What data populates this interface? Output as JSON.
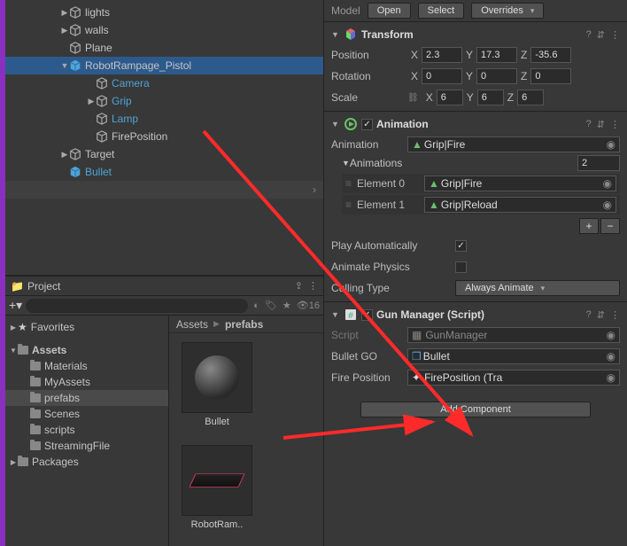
{
  "hierarchy": {
    "items": [
      {
        "name": "lights",
        "indent": 56,
        "arrow": "closed",
        "icon": "cube",
        "blue": false
      },
      {
        "name": "walls",
        "indent": 56,
        "arrow": "closed",
        "icon": "cube",
        "blue": false
      },
      {
        "name": "Plane",
        "indent": 56,
        "arrow": "",
        "icon": "cube",
        "blue": false
      },
      {
        "name": "RobotRampage_Pistol",
        "indent": 56,
        "arrow": "open",
        "icon": "prefab",
        "blue": false,
        "sel": true
      },
      {
        "name": "Camera",
        "indent": 86,
        "arrow": "",
        "icon": "cube",
        "blue": true
      },
      {
        "name": "Grip",
        "indent": 86,
        "arrow": "closed",
        "icon": "cube",
        "blue": true
      },
      {
        "name": "Lamp",
        "indent": 86,
        "arrow": "",
        "icon": "cube",
        "blue": true
      },
      {
        "name": "FirePosition",
        "indent": 86,
        "arrow": "",
        "icon": "cube",
        "blue": false
      },
      {
        "name": "Target",
        "indent": 56,
        "arrow": "closed",
        "icon": "cube",
        "blue": false
      },
      {
        "name": "Bullet",
        "indent": 56,
        "arrow": "",
        "icon": "prefab",
        "blue": true
      }
    ],
    "last_arrow": "›"
  },
  "project": {
    "title": "Project",
    "lock_icon": "⇪",
    "menu_icon": "⋮",
    "search_placeholder": "",
    "visibility_count": "16",
    "favorites": "Favorites",
    "assets": "Assets",
    "folders": [
      "Materials",
      "MyAssets",
      "prefabs",
      "Scenes",
      "scripts",
      "StreamingFile"
    ],
    "selected_folder": "prefabs",
    "packages": "Packages",
    "crumb_root": "Assets",
    "crumb_leaf": "prefabs",
    "thumbs": [
      {
        "name": "Bullet",
        "kind": "sphere"
      },
      {
        "name": "RobotRam..",
        "kind": "ramp"
      }
    ]
  },
  "inspector": {
    "model_label": "Model",
    "open": "Open",
    "select": "Select",
    "overrides": "Overrides",
    "transform": {
      "title": "Transform",
      "position": "Position",
      "rotation": "Rotation",
      "scale": "Scale",
      "pos": {
        "x": "2.3",
        "y": "17.3",
        "z": "-35.6"
      },
      "rot": {
        "x": "0",
        "y": "0",
        "z": "0"
      },
      "scl": {
        "x": "6",
        "y": "6",
        "z": "6"
      }
    },
    "animation": {
      "title": "Animation",
      "field_label": "Animation",
      "clip": "Grip|Fire",
      "list_label": "Animations",
      "size": "2",
      "elements": [
        {
          "label": "Element 0",
          "clip": "Grip|Fire"
        },
        {
          "label": "Element 1",
          "clip": "Grip|Reload"
        }
      ],
      "play_auto": "Play Automatically",
      "anim_phys": "Animate Physics",
      "culling": "Culling Type",
      "culling_val": "Always Animate"
    },
    "gun": {
      "title": "Gun Manager (Script)",
      "script_label": "Script",
      "script_val": "GunManager",
      "bullet_label": "Bullet GO",
      "bullet_val": "Bullet",
      "fire_label": "Fire Position",
      "fire_val": "FirePosition (Tra"
    },
    "add_component": "Add Component"
  }
}
